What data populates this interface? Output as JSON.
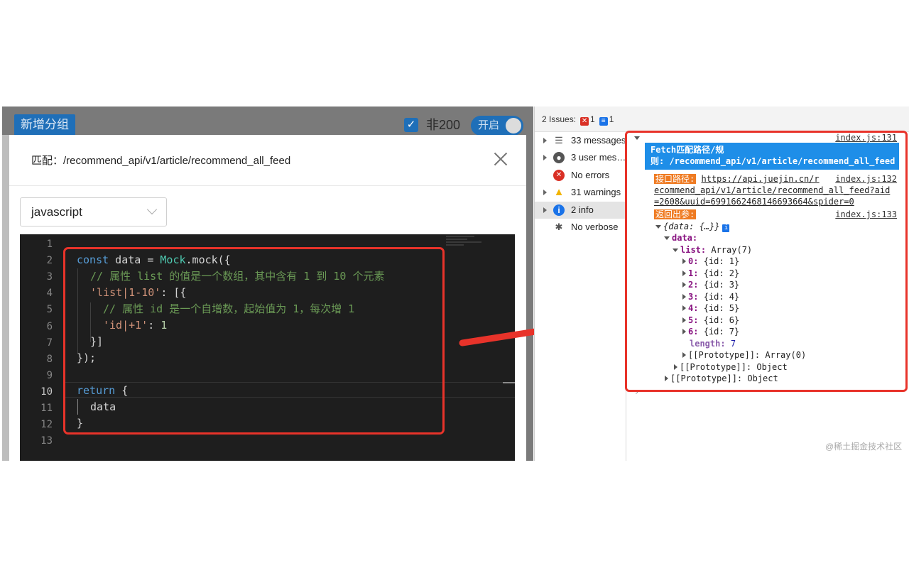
{
  "left": {
    "add_group": "新增分组",
    "non200_label": "非200",
    "toggle_label": "开启",
    "modal_title": "匹配：/recommend_api/v1/article/recommend_all_feed",
    "language": "javascript",
    "line_numbers": [
      "1",
      "2",
      "3",
      "4",
      "5",
      "6",
      "7",
      "8",
      "9",
      "10",
      "11",
      "12",
      "13"
    ],
    "code": {
      "l2": {
        "kw": "const",
        "mid": " data = ",
        "cls": "Mock",
        "tail": ".mock({"
      },
      "l3": "// 属性 list 的值是一个数组，其中含有 1 到 10 个元素",
      "l4": {
        "str": "'list|1-10'",
        "tail": ": [{"
      },
      "l5": "// 属性 id 是一个自增数，起始值为 1，每次增 1",
      "l6": {
        "str": "'id|+1'",
        "mid": ": ",
        "num": "1"
      },
      "l7": "}]",
      "l8": "});",
      "l10": {
        "kw": "return",
        "tail": " {"
      },
      "l11": "data",
      "l12": "}"
    }
  },
  "devtools": {
    "issues_label": "2 Issues:",
    "issues_errors": "1",
    "issues_info": "1",
    "sidebar": [
      {
        "label": "33 messages",
        "icon": "list-icon"
      },
      {
        "label": "3 user mes…",
        "icon": "user-icon"
      },
      {
        "label": "No errors",
        "icon": "error-icon"
      },
      {
        "label": "31 warnings",
        "icon": "warning-icon"
      },
      {
        "label": "2 info",
        "icon": "info-icon"
      },
      {
        "label": "No verbose",
        "icon": "bug-icon"
      }
    ],
    "console": {
      "src1": "index.js:131",
      "fetch_line1": "Fetch匹配路径/规",
      "fetch_line2": "则: /recommend_api/v1/article/recommend_all_feed",
      "api_tag": "接口路径:",
      "api_url1": "https://api.juejin.cn/r",
      "src2": "index.js:132",
      "api_url2": "ecommend_api/v1/article/recommend_all_feed?aid",
      "api_url3": "=2608&uuid=6991662468146693664&spider=0",
      "ret_tag": "返回出参:",
      "src3": "index.js:133",
      "obj_preview": "{data: {…}}",
      "data_key": "data:",
      "list_key": "list:",
      "list_val": "Array(7)",
      "items": [
        {
          "k": "0:",
          "v": "{id: 1}"
        },
        {
          "k": "1:",
          "v": "{id: 2}"
        },
        {
          "k": "2:",
          "v": "{id: 3}"
        },
        {
          "k": "3:",
          "v": "{id: 4}"
        },
        {
          "k": "4:",
          "v": "{id: 5}"
        },
        {
          "k": "5:",
          "v": "{id: 6}"
        },
        {
          "k": "6:",
          "v": "{id: 7}"
        }
      ],
      "length_key": "length:",
      "length_val": "7",
      "proto_array": "[[Prototype]]: Array(0)",
      "proto_obj1": "[[Prototype]]: Object",
      "proto_obj2": "[[Prototype]]: Object"
    }
  },
  "watermark": "@稀土掘金技术社区"
}
